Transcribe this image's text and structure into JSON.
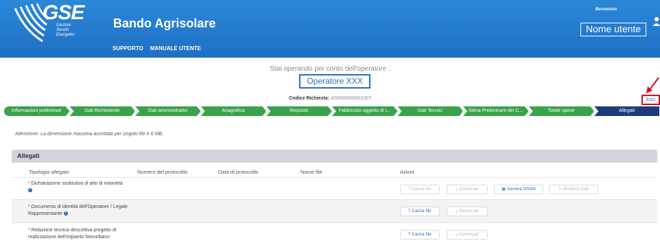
{
  "header": {
    "logo_text": "GSE",
    "logo_sub": [
      "Gestore",
      "Servizi",
      "Energetici"
    ],
    "app_title": "Bando Agrisolare",
    "nav": [
      "SUPPORTO",
      "MANUALE UTENTE"
    ],
    "welcome": "Benvenuto",
    "username": "Nome utente",
    "brand_color": "#1f6fc4"
  },
  "operator": {
    "operating_text": "Stai operando per conto dell'operatore :",
    "operator_name": "Operatore XXX",
    "codice_label": "Codice Richiesta:",
    "codice_value": "AGRS0000001007",
    "exit_label": "Esci"
  },
  "steps": [
    "Informazioni preliminari",
    "Dati Richiedente",
    "Dati amministrativi",
    "Anagrafica",
    "Requisiti",
    "Fabbricato oggetto di i...",
    "Dati Tecnici",
    "Stima Preliminare dei C...",
    "Totale spese",
    "Allegati"
  ],
  "active_step": "Allegati",
  "warning": "Attenzione: La dimensione massima accettata per singolo file è 6 MB.",
  "section_title": "Allegati",
  "columns": [
    "Tipologia allegato",
    "Numero del protocollo",
    "Data di protocollo",
    "Nome file",
    "Azioni"
  ],
  "rows": [
    {
      "label": "Dichiarazione sostitutiva di atto di notorietà",
      "buttons": [
        "Carica file",
        "Download",
        "Genera DSAN",
        "Modifica Dati"
      ]
    },
    {
      "label": "Documento di identità dell'Operatore / Legale Rappresentante",
      "buttons": [
        "Carica file",
        "Download"
      ]
    },
    {
      "label": "Relazione tecnica descrittiva progetto di realizzazione dell'impianto fotovoltaico",
      "buttons": [
        "Carica file",
        "Download"
      ]
    }
  ],
  "colors": {
    "step_done": "#3aa24a",
    "step_active": "#1e3c7a",
    "highlight": "#e0001b"
  }
}
